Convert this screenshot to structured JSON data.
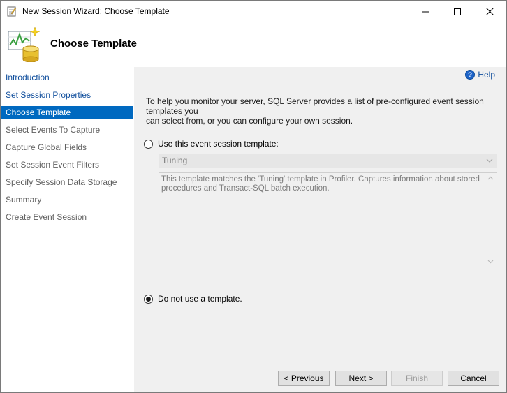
{
  "window": {
    "title": "New Session Wizard: Choose Template"
  },
  "header": {
    "title": "Choose Template"
  },
  "sidebar": {
    "items": [
      {
        "label": "Introduction",
        "state": "link"
      },
      {
        "label": "Set Session Properties",
        "state": "link"
      },
      {
        "label": "Choose Template",
        "state": "active"
      },
      {
        "label": "Select Events To Capture",
        "state": "disabled"
      },
      {
        "label": "Capture Global Fields",
        "state": "disabled"
      },
      {
        "label": "Set Session Event Filters",
        "state": "disabled"
      },
      {
        "label": "Specify Session Data Storage",
        "state": "disabled"
      },
      {
        "label": "Summary",
        "state": "disabled"
      },
      {
        "label": "Create Event Session",
        "state": "disabled"
      }
    ]
  },
  "main": {
    "help_label": "Help",
    "intro_line1": "To help you monitor your server, SQL Server provides a list of pre-configured event session templates you",
    "intro_line2": "can select from, or you can configure your own session.",
    "option_template": {
      "label": "Use this event session template:",
      "selected": false
    },
    "template_select": {
      "value": "Tuning"
    },
    "template_description_line1": "This template matches the 'Tuning' template in Profiler. Captures information about stored",
    "template_description_line2": "procedures and Transact-SQL batch execution.",
    "option_no_template": {
      "label": "Do not use a template.",
      "selected": true
    }
  },
  "footer": {
    "previous_label": "< Previous",
    "next_label": "Next >",
    "finish_label": "Finish",
    "cancel_label": "Cancel"
  },
  "colors": {
    "active_nav": "#0069c0",
    "link": "#0d4c9b",
    "panel_bg": "#f0f0f0"
  },
  "icons": {
    "app": "wizard-document-icon",
    "header": "session-database-chart-icon",
    "help": "help-circle-icon"
  }
}
